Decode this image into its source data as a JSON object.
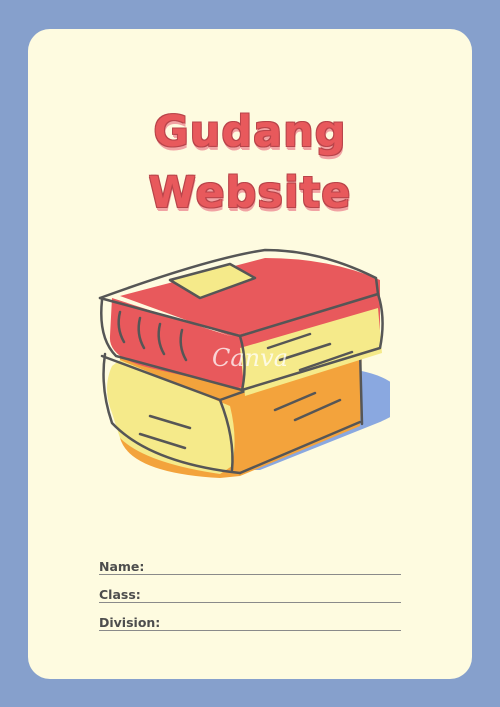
{
  "title": {
    "line1": "Gudang",
    "line2": "Website"
  },
  "watermark": "Canva",
  "fields": {
    "name": "Name:",
    "class": "Class:",
    "division": "Division:"
  },
  "colors": {
    "background": "#86a0cc",
    "page": "#fefbe0",
    "title": "#e8595c",
    "book_red": "#e8595c",
    "book_yellow": "#f5ea8a",
    "book_orange": "#f3a33c",
    "shadow_blue": "#7d9ee0"
  },
  "illustration": {
    "icon": "stack-of-books-icon"
  }
}
